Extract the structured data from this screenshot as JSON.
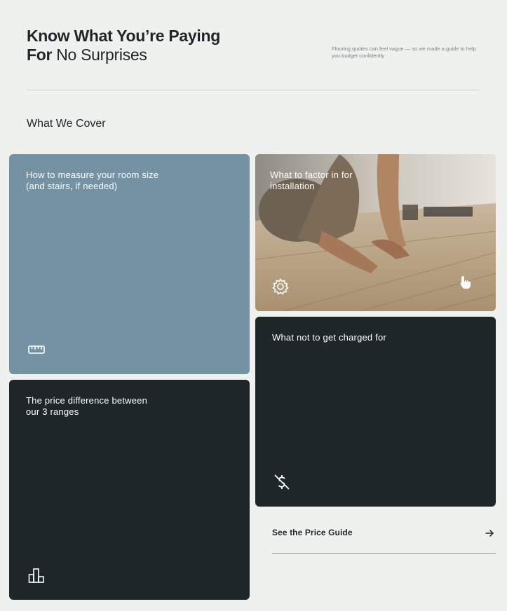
{
  "header": {
    "title_line1": "Know What You’re Paying",
    "title_line2_bold": "For",
    "title_line2_light": "No Surprises",
    "intro": "Flooring quotes can feel vague — so we made a guide to help you budget confidently"
  },
  "section": {
    "title": "What We Cover"
  },
  "cards": {
    "measure": {
      "label": "How to measure your room size (and stairs, if needed)",
      "icon": "ruler-icon",
      "color": "#7592a5"
    },
    "install": {
      "label": "What to factor in for installation",
      "icon": "gear-icon",
      "secondary_icon": "hand-pointer-icon"
    },
    "price": {
      "label": "The price difference between our 3 ranges",
      "icon": "bar-chart-icon",
      "color": "#1f2629"
    },
    "charged": {
      "label": "What not to get charged for",
      "icon": "no-dollar-icon",
      "color": "#1f2629"
    }
  },
  "cta": {
    "label": "See the Price Guide",
    "icon": "arrow-right-icon"
  }
}
